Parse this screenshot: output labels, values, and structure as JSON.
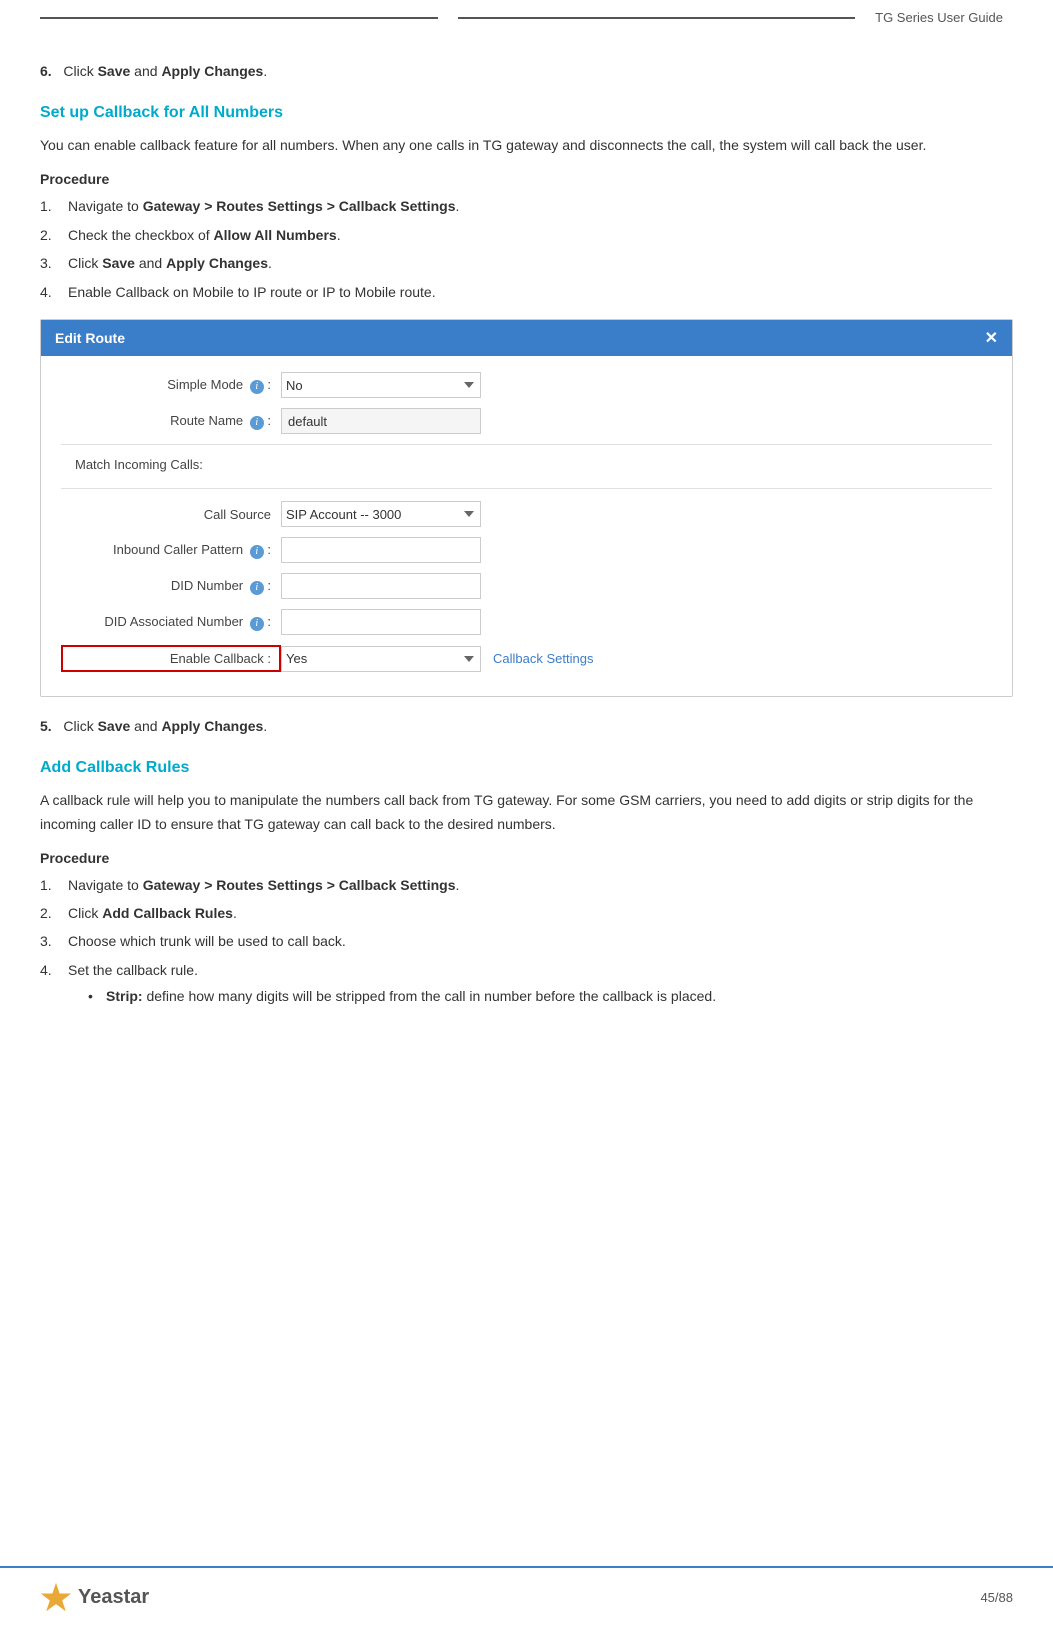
{
  "header": {
    "title": "TG  Series  User  Guide"
  },
  "step6": {
    "text": "Click ",
    "save": "Save",
    "and": " and ",
    "apply": "Apply Changes",
    "period": "."
  },
  "section1": {
    "heading": "Set up Callback for All Numbers",
    "paragraph": "You can enable callback feature for all numbers. When any one calls in TG gateway and disconnects the call, the system will call back the user.",
    "procedure": "Procedure",
    "steps": [
      {
        "num": "1.",
        "text": "Navigate to ",
        "bold": "Gateway > Routes Settings > Callback Settings",
        "rest": "."
      },
      {
        "num": "2.",
        "text": "Check the checkbox of ",
        "bold": "Allow All Numbers",
        "rest": "."
      },
      {
        "num": "3.",
        "text": "Click ",
        "bold1": "Save",
        "and": " and ",
        "bold2": "Apply Changes",
        "rest": "."
      },
      {
        "num": "4.",
        "text": "Enable Callback on Mobile to IP route or IP to Mobile route."
      }
    ]
  },
  "dialog": {
    "title": "Edit Route",
    "close": "✕",
    "simple_mode_label": "Simple Mode",
    "simple_mode_value": "No",
    "route_name_label": "Route Name",
    "route_name_value": "default",
    "match_incoming_label": "Match Incoming Calls:",
    "call_source_label": "Call Source",
    "call_source_value": "SIP Account -- 3000",
    "inbound_caller_label": "Inbound Caller Pattern",
    "did_number_label": "DID Number",
    "did_associated_label": "DID Associated Number",
    "enable_callback_label": "Enable Callback :",
    "enable_callback_value": "Yes",
    "callback_settings_link": "Callback Settings"
  },
  "step5": {
    "text": "Click ",
    "save": "Save",
    "and": " and ",
    "apply": "Apply Changes",
    "period": "."
  },
  "section2": {
    "heading": "Add Callback Rules",
    "paragraph": "A callback rule will help you to manipulate the numbers call back from TG gateway. For some GSM carriers, you need to add digits or strip digits for the incoming caller ID to ensure that TG gateway can call back to the desired numbers.",
    "procedure": "Procedure",
    "steps": [
      {
        "num": "1.",
        "text": "Navigate to ",
        "bold": "Gateway > Routes Settings > Callback Settings",
        "rest": "."
      },
      {
        "num": "2.",
        "text": "Click ",
        "bold": "Add Callback Rules",
        "rest": "."
      },
      {
        "num": "3.",
        "text": "Choose which trunk will be used to call back."
      },
      {
        "num": "4.",
        "text": "Set the callback rule."
      }
    ],
    "bullet": {
      "term": "Strip:",
      "def": " define how many digits will be stripped from the call in number before the callback is placed."
    }
  },
  "footer": {
    "logo_text": "Yeastar",
    "page": "45/88"
  }
}
